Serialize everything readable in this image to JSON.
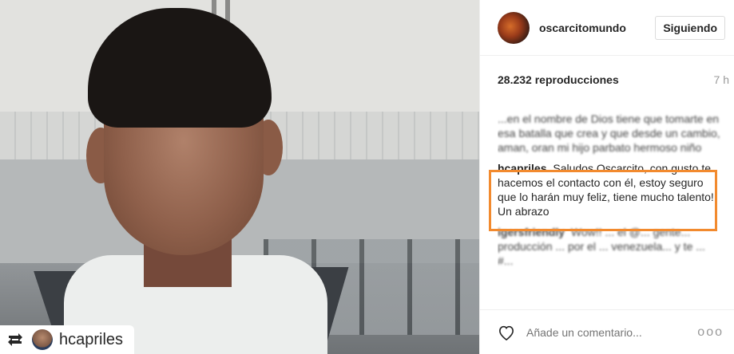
{
  "post": {
    "username": "oscarcitomundo",
    "follow_label": "Siguiendo",
    "views": "28.232 reproducciones",
    "time_ago": "7 h",
    "repost_username": "hcapriles"
  },
  "comments": [
    {
      "user": "",
      "text": "...en el nombre de Dios tiene que tomarte en esa batalla que crea y que desde un cambio, aman, oran mi hijo parbato hermoso niño",
      "blurred": true
    },
    {
      "user": "hcapriles",
      "text": "Saludos Oscarcito, con gusto te hacemos el contacto con él, estoy seguro que lo harán muy feliz, tiene mucho talento! Un abrazo",
      "blurred": false
    },
    {
      "user": "igersfriendly",
      "text": "Wow!! ... el @... gente... producción ... por el ... venezuela... y te ... #...",
      "blurred": true
    }
  ],
  "footer": {
    "comment_placeholder": "Añade un comentario...",
    "more_label": "ooo"
  },
  "icons": {
    "repost": "repost-icon",
    "like": "heart-icon",
    "more": "more-options-icon"
  }
}
